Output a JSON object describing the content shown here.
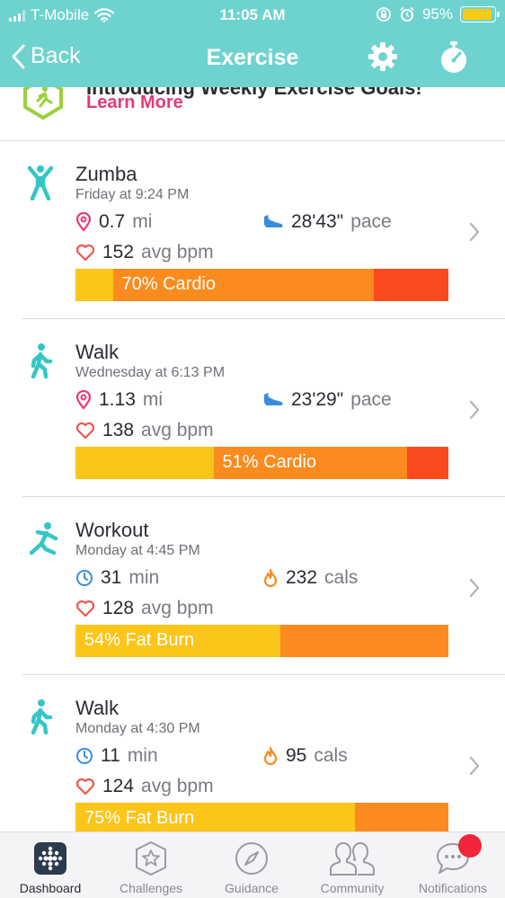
{
  "status_bar": {
    "carrier": "T-Mobile",
    "time": "11:05 AM",
    "battery": "95%",
    "battery_level": 0.95
  },
  "nav": {
    "back_label": "Back",
    "title": "Exercise"
  },
  "promo": {
    "title": "Introducing Weekly Exercise Goals!",
    "link": "Learn More"
  },
  "entries": [
    {
      "name": "Zumba",
      "when": "Friday at 9:24 PM",
      "stat1_value": "0.7",
      "stat1_unit": "mi",
      "stat2_value": "28'43\"",
      "stat2_unit": "pace",
      "stat3_value": "152",
      "stat3_unit": "avg bpm",
      "zone_label": "70% Cardio",
      "zones": [
        0.1,
        0.7,
        0.2
      ]
    },
    {
      "name": "Walk",
      "when": "Wednesday at 6:13 PM",
      "stat1_value": "1.13",
      "stat1_unit": "mi",
      "stat2_value": "23'29\"",
      "stat2_unit": "pace",
      "stat3_value": "138",
      "stat3_unit": "avg bpm",
      "zone_label": "51% Cardio",
      "zones": [
        0.37,
        0.52,
        0.11
      ]
    },
    {
      "name": "Workout",
      "when": "Monday at 4:45 PM",
      "stat1_value": "31",
      "stat1_unit": "min",
      "stat2_value": "232",
      "stat2_unit": "cals",
      "stat3_value": "128",
      "stat3_unit": "avg bpm",
      "zone_label": "54% Fat Burn",
      "zones": [
        0.55,
        0.45,
        0
      ]
    },
    {
      "name": "Walk",
      "when": "Monday at 4:30 PM",
      "stat1_value": "11",
      "stat1_unit": "min",
      "stat2_value": "95",
      "stat2_unit": "cals",
      "stat3_value": "124",
      "stat3_unit": "avg bpm",
      "zone_label": "75% Fat Burn",
      "zones": [
        0.75,
        0.25,
        0
      ]
    }
  ],
  "zone_colors": [
    "#fbc51a",
    "#fb8b1f",
    "#fc4a1f"
  ],
  "accent": "#6ed3cf",
  "tabs": [
    {
      "label": "Dashboard",
      "icon": "dashboard-icon"
    },
    {
      "label": "Challenges",
      "icon": "star-badge-icon"
    },
    {
      "label": "Guidance",
      "icon": "compass-icon"
    },
    {
      "label": "Community",
      "icon": "people-icon"
    },
    {
      "label": "Notifications",
      "icon": "chat-bubble-icon"
    }
  ]
}
